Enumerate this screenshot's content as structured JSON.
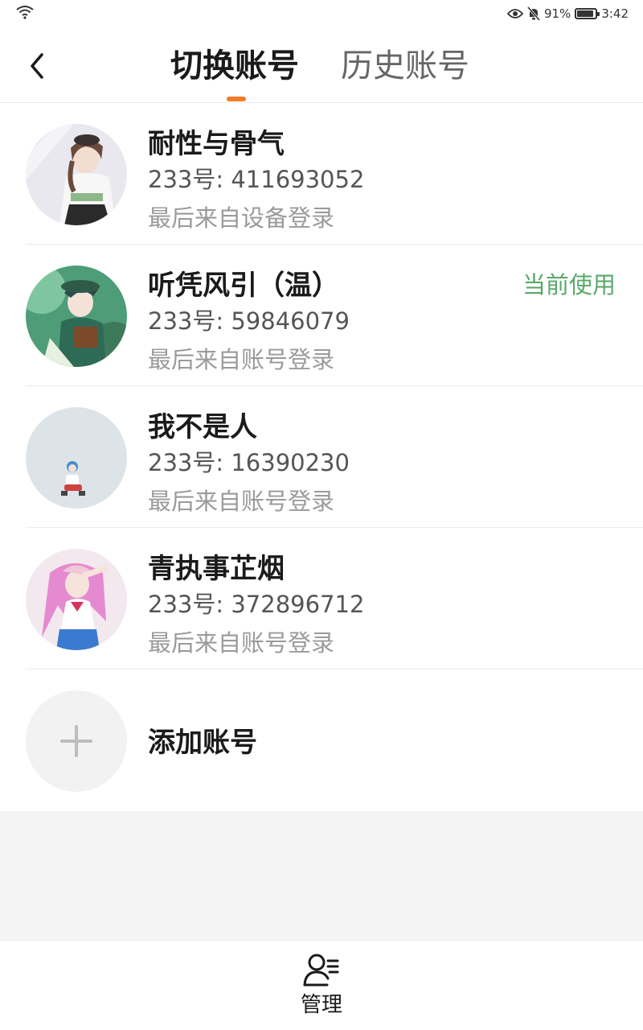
{
  "status_bar": {
    "battery_text": "91%",
    "battery_level": 0.91,
    "time": "3:42",
    "icons": [
      "wifi-icon",
      "eye-icon",
      "bell-off-icon",
      "battery-icon"
    ]
  },
  "header": {
    "back_icon": "chevron-left-icon",
    "tabs": [
      {
        "label": "切换账号",
        "active": true
      },
      {
        "label": "历史账号",
        "active": false
      }
    ]
  },
  "accounts": [
    {
      "name": "耐性与骨气",
      "id_text": "233号: 411693052",
      "last_login": "最后来自设备登录",
      "current": ""
    },
    {
      "name": "听凭风引（温）",
      "id_text": "233号: 59846079",
      "last_login": "最后来自账号登录",
      "current": "当前使用"
    },
    {
      "name": "我不是人",
      "id_text": "233号: 16390230",
      "last_login": "最后来自账号登录",
      "current": ""
    },
    {
      "name": "青执事芷烟",
      "id_text": "233号: 372896712",
      "last_login": "最后来自账号登录",
      "current": ""
    }
  ],
  "add_account": {
    "label": "添加账号",
    "icon": "plus-icon"
  },
  "bottom_bar": {
    "manage_label": "管理",
    "manage_icon": "manage-user-icon"
  },
  "colors": {
    "accent_orange": "#f07c2c",
    "current_green": "#5aa869",
    "background_gray": "#f4f4f4"
  }
}
